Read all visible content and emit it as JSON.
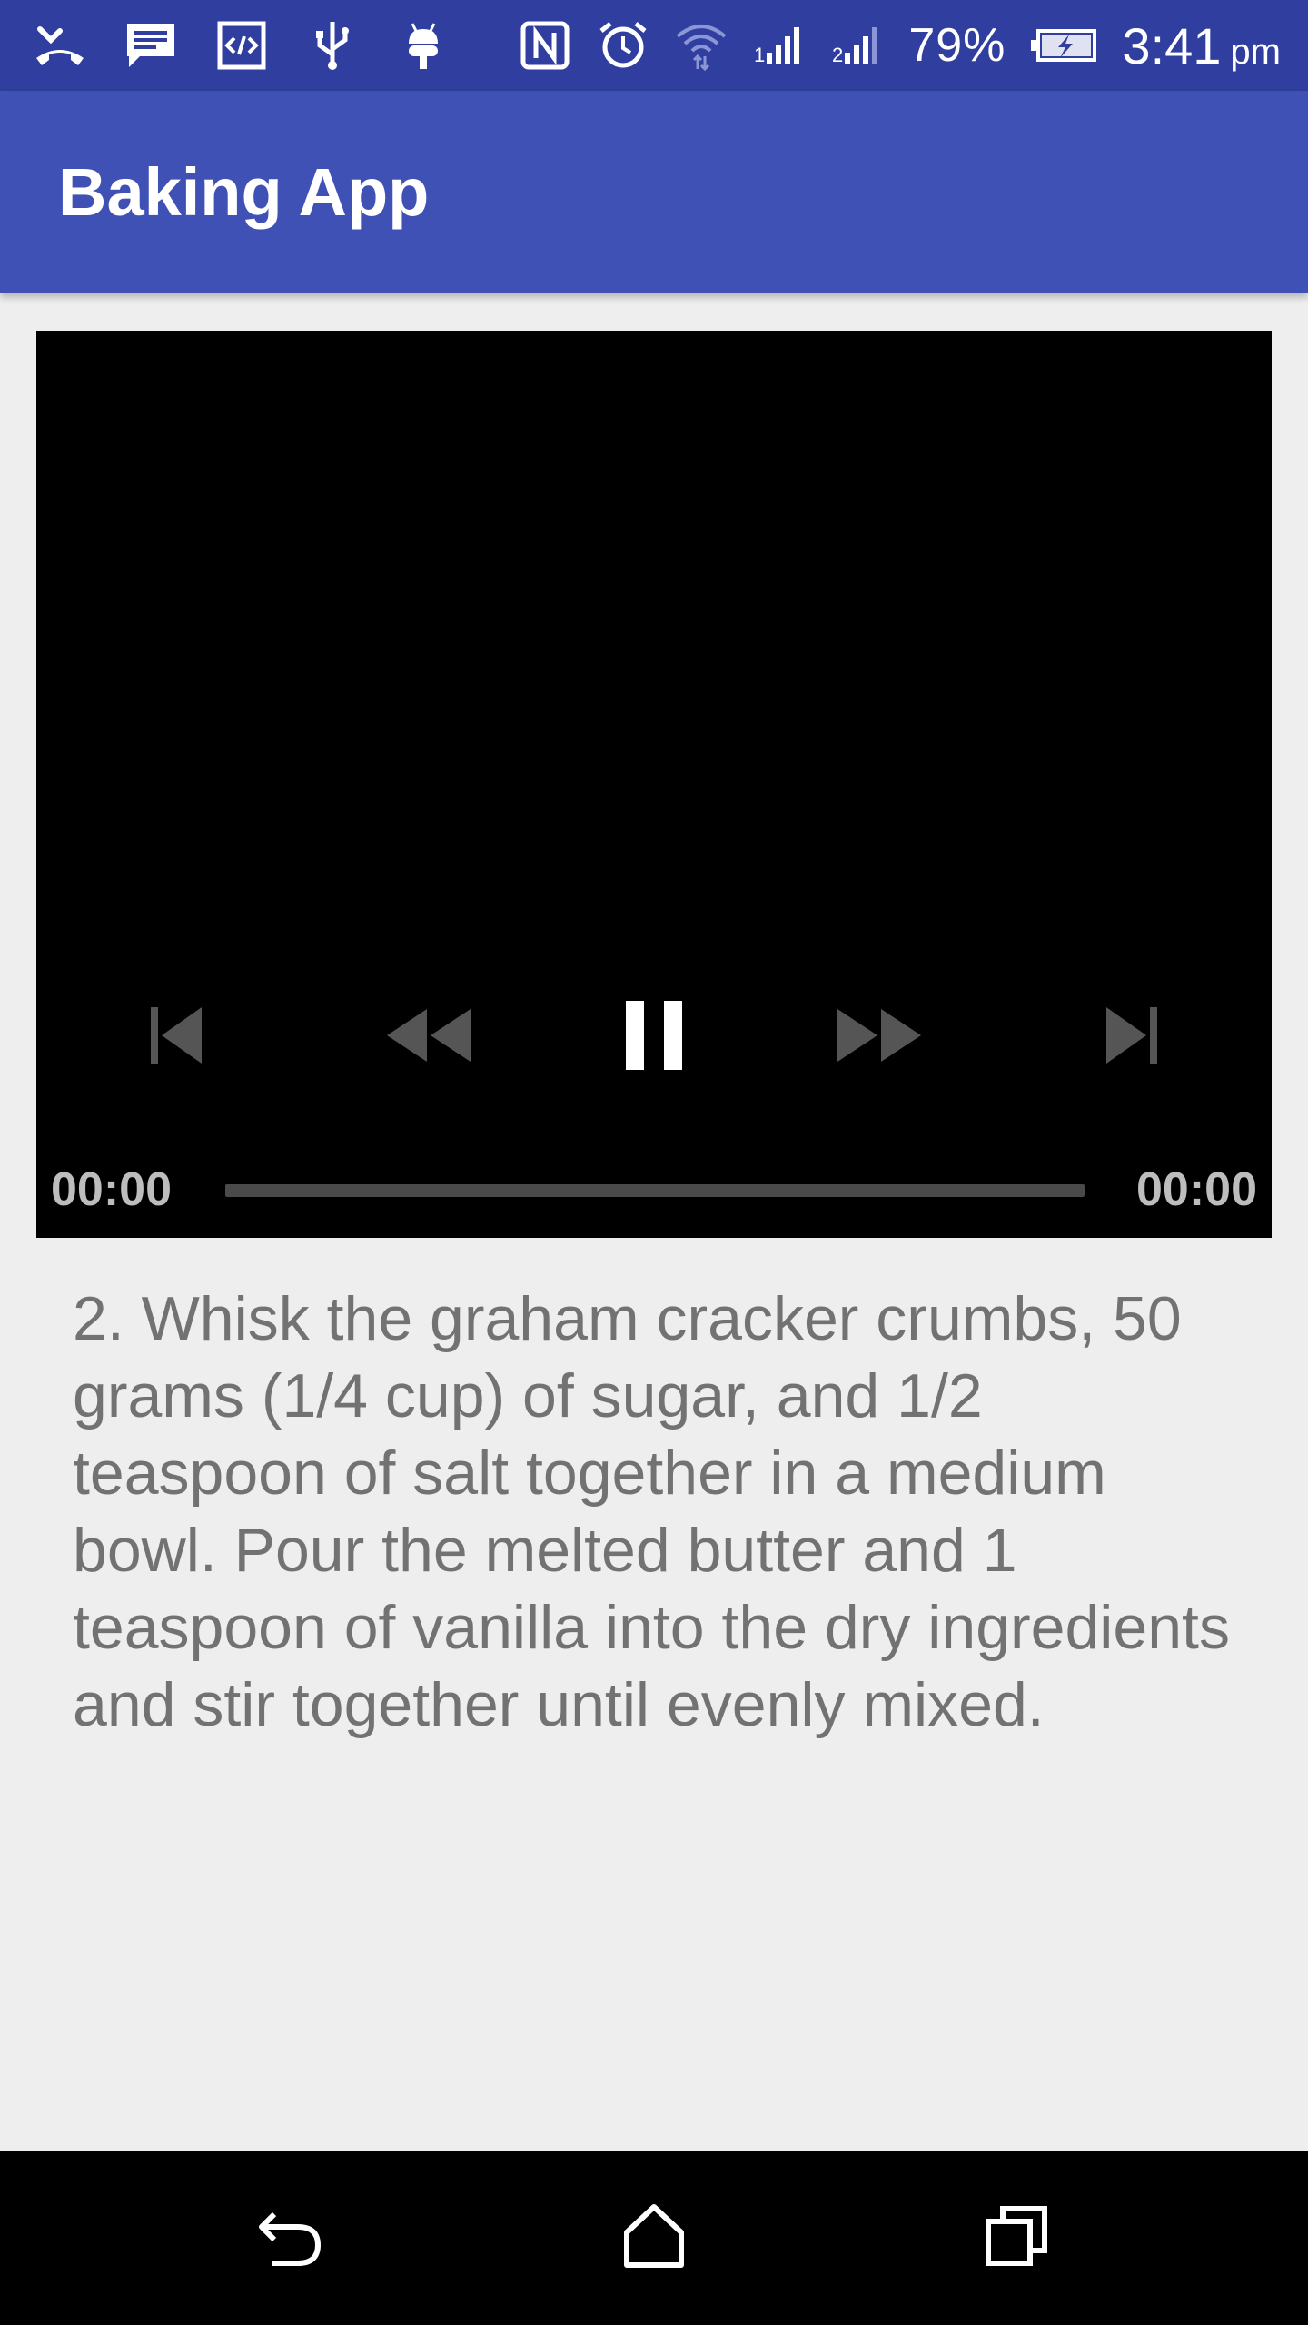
{
  "status_bar": {
    "battery_percent": "79%",
    "time": "3:41",
    "ampm": "pm",
    "left_icons": [
      "missed-call-icon",
      "message-icon",
      "developer-code-icon",
      "usb-icon",
      "android-debug-icon"
    ],
    "right_icons": [
      "nfc-icon",
      "alarm-icon",
      "wifi-icon",
      "signal-1-icon",
      "signal-2-icon",
      "battery-charging-icon"
    ]
  },
  "app_bar": {
    "title": "Baking App"
  },
  "player": {
    "position_time": "00:00",
    "duration_time": "00:00",
    "progress": 0,
    "controls": [
      "previous-icon",
      "rewind-icon",
      "pause-icon",
      "fast-forward-icon",
      "next-icon"
    ]
  },
  "step": {
    "description": "2. Whisk the graham cracker crumbs, 50 grams (1/4 cup) of sugar, and 1/2 teaspoon of salt together in a medium bowl. Pour the melted butter and 1 teaspoon of vanilla into the dry ingredients and stir together until evenly mixed."
  },
  "nav_bar": {
    "buttons": [
      "back-icon",
      "home-icon",
      "recents-icon"
    ]
  },
  "colors": {
    "status_bar": "#303f9f",
    "app_bar": "#3f51b5",
    "background": "#eeeeee",
    "player_background": "#000000",
    "description_text": "#727272"
  }
}
